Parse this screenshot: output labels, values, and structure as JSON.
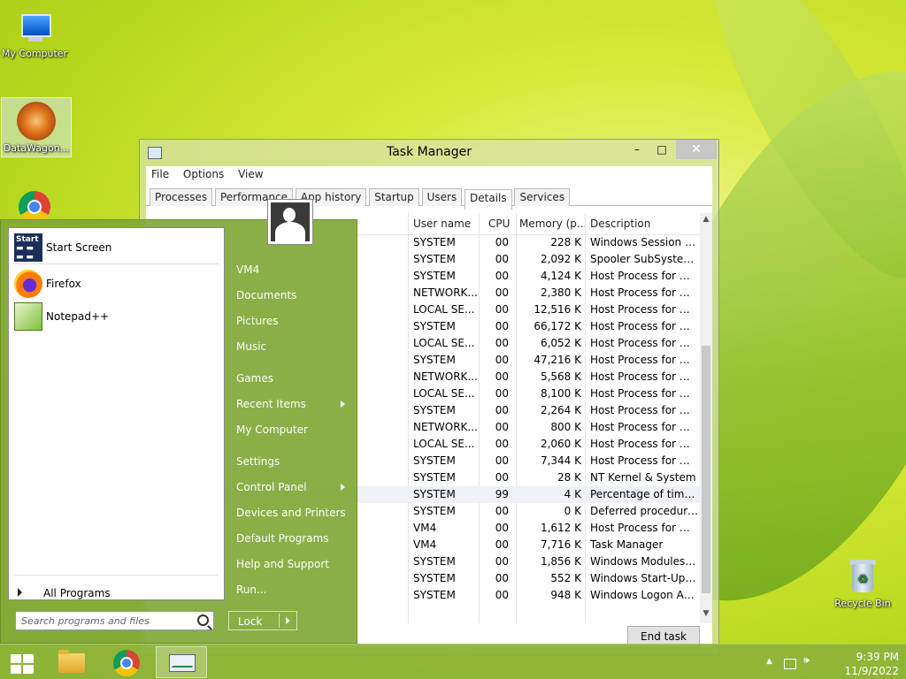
{
  "desktop": {
    "icons": [
      {
        "label": "My Computer"
      },
      {
        "label": "DataWagon..."
      },
      {
        "label": "Recycle Bin"
      }
    ]
  },
  "task_manager": {
    "title": "Task Manager",
    "window_controls": {
      "minimize": "–",
      "maximize": "□",
      "close": "✕"
    },
    "menu": [
      "File",
      "Options",
      "View"
    ],
    "tabs": [
      "Processes",
      "Performance",
      "App history",
      "Startup",
      "Users",
      "Details",
      "Services"
    ],
    "active_tab": "Details",
    "columns": {
      "user": "User name",
      "cpu": "CPU",
      "memory": "Memory (p...",
      "description": "Description"
    },
    "rows": [
      {
        "user": "SYSTEM",
        "cpu": "00",
        "mem": "228 K",
        "desc": "Windows Session M..."
      },
      {
        "user": "SYSTEM",
        "cpu": "00",
        "mem": "2,092 K",
        "desc": "Spooler SubSystem ..."
      },
      {
        "user": "SYSTEM",
        "cpu": "00",
        "mem": "4,124 K",
        "desc": "Host Process for Wi..."
      },
      {
        "user": "NETWORK...",
        "cpu": "00",
        "mem": "2,380 K",
        "desc": "Host Process for Wi..."
      },
      {
        "user": "LOCAL SE...",
        "cpu": "00",
        "mem": "12,516 K",
        "desc": "Host Process for Wi..."
      },
      {
        "user": "SYSTEM",
        "cpu": "00",
        "mem": "66,172 K",
        "desc": "Host Process for Wi..."
      },
      {
        "user": "LOCAL SE...",
        "cpu": "00",
        "mem": "6,052 K",
        "desc": "Host Process for Wi..."
      },
      {
        "user": "SYSTEM",
        "cpu": "00",
        "mem": "47,216 K",
        "desc": "Host Process for Wi..."
      },
      {
        "user": "NETWORK...",
        "cpu": "00",
        "mem": "5,568 K",
        "desc": "Host Process for Wi..."
      },
      {
        "user": "LOCAL SE...",
        "cpu": "00",
        "mem": "8,100 K",
        "desc": "Host Process for Wi..."
      },
      {
        "user": "SYSTEM",
        "cpu": "00",
        "mem": "2,264 K",
        "desc": "Host Process for Wi..."
      },
      {
        "user": "NETWORK...",
        "cpu": "00",
        "mem": "800 K",
        "desc": "Host Process for Wi..."
      },
      {
        "user": "LOCAL SE...",
        "cpu": "00",
        "mem": "2,060 K",
        "desc": "Host Process for Wi..."
      },
      {
        "user": "SYSTEM",
        "cpu": "00",
        "mem": "7,344 K",
        "desc": "Host Process for Wi..."
      },
      {
        "user": "SYSTEM",
        "cpu": "00",
        "mem": "28 K",
        "desc": "NT Kernel & System"
      },
      {
        "user": "SYSTEM",
        "cpu": "99",
        "mem": "4 K",
        "desc": "Percentage of time t..."
      },
      {
        "user": "SYSTEM",
        "cpu": "00",
        "mem": "0 K",
        "desc": "Deferred procedure ..."
      },
      {
        "user": "VM4",
        "cpu": "00",
        "mem": "1,612 K",
        "desc": "Host Process for Wi..."
      },
      {
        "user": "VM4",
        "cpu": "00",
        "mem": "7,716 K",
        "desc": "Task Manager"
      },
      {
        "user": "SYSTEM",
        "cpu": "00",
        "mem": "1,856 K",
        "desc": "Windows Modules I..."
      },
      {
        "user": "SYSTEM",
        "cpu": "00",
        "mem": "552 K",
        "desc": "Windows Start-Up A..."
      },
      {
        "user": "SYSTEM",
        "cpu": "00",
        "mem": "948 K",
        "desc": "Windows Logon Ap..."
      }
    ],
    "end_task": "End task"
  },
  "start_menu": {
    "pinned": [
      "Start Screen",
      "Firefox",
      "Notepad++"
    ],
    "start_screen_icon_text": "Start",
    "all_programs": "All Programs",
    "search_placeholder": "Search programs and files",
    "right_links": [
      "VM4",
      "Documents",
      "Pictures",
      "Music",
      "Games",
      "Recent Items",
      "My Computer",
      "Settings",
      "Control Panel",
      "Devices and Printers",
      "Default Programs",
      "Help and Support",
      "Run..."
    ],
    "lock": "Lock"
  },
  "taskbar": {
    "clock_time": "9:39 PM",
    "clock_date": "11/9/2022"
  }
}
